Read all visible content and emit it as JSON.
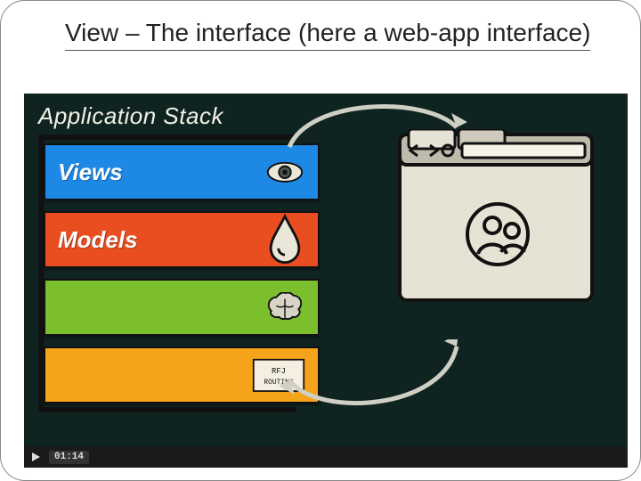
{
  "title": "View – The interface (here a web-app interface)",
  "diagram": {
    "heading": "Application Stack",
    "layers": [
      {
        "label": "Views",
        "icon": "eye-icon",
        "color": "#1e88e5"
      },
      {
        "label": "Models",
        "icon": "droplet-icon",
        "color": "#e94e20"
      },
      {
        "label": "",
        "icon": "brain-icon",
        "color": "#7bbf2f"
      },
      {
        "label": "",
        "icon": "routing-icon",
        "color": "#f4a31a"
      }
    ],
    "routing_card": {
      "line1": "RFJ",
      "line2": "ROUTING"
    },
    "browser_icon": "user-share-icon",
    "arrows": "bidirectional-cycle"
  },
  "player": {
    "state": "paused",
    "timecode": "01:14"
  }
}
